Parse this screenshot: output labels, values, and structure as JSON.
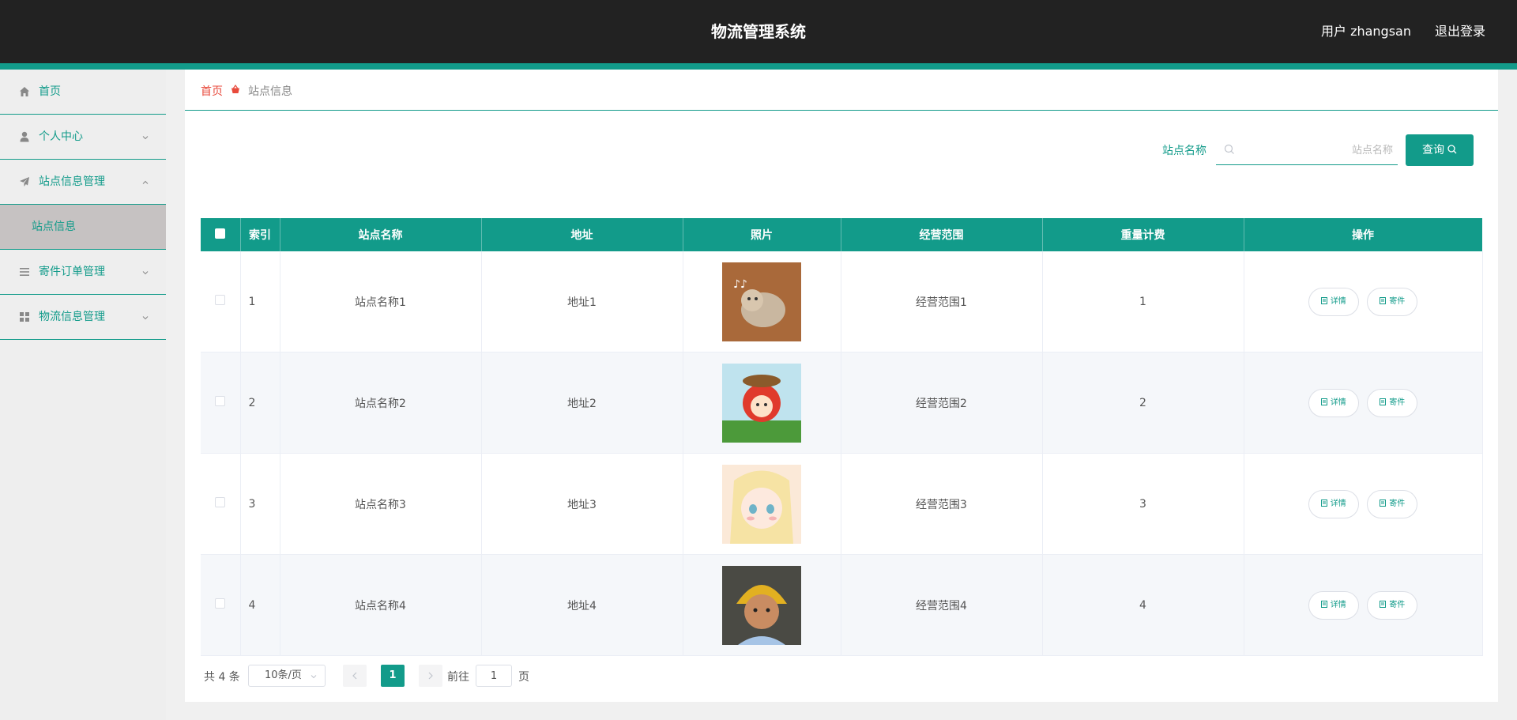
{
  "header": {
    "title": "物流管理系统",
    "user": "用户 zhangsan",
    "logout": "退出登录"
  },
  "sidebar": {
    "items": [
      {
        "label": "首页",
        "icon": "home-icon"
      },
      {
        "label": "个人中心",
        "icon": "user-icon"
      },
      {
        "label": "站点信息管理",
        "icon": "send-icon"
      },
      {
        "label": "寄件订单管理",
        "icon": "list-icon"
      },
      {
        "label": "物流信息管理",
        "icon": "grid-icon"
      }
    ],
    "submenu": [
      "站点信息"
    ]
  },
  "breadcrumb": {
    "home": "首页",
    "current": "站点信息"
  },
  "search": {
    "label": "站点名称",
    "placeholder": "站点名称",
    "button": "查询"
  },
  "table": {
    "columns": [
      "索引",
      "站点名称",
      "地址",
      "照片",
      "经营范围",
      "重量计费",
      "操作"
    ],
    "rows": [
      {
        "index": "1",
        "name": "站点名称1",
        "address": "地址1",
        "scope": "经营范围1",
        "fee": "1"
      },
      {
        "index": "2",
        "name": "站点名称2",
        "address": "地址2",
        "scope": "经营范围2",
        "fee": "2"
      },
      {
        "index": "3",
        "name": "站点名称3",
        "address": "地址3",
        "scope": "经营范围3",
        "fee": "3"
      },
      {
        "index": "4",
        "name": "站点名称4",
        "address": "地址4",
        "scope": "经营范围4",
        "fee": "4"
      }
    ],
    "actions": {
      "detail": "详情",
      "send": "寄件"
    }
  },
  "pagination": {
    "total": "共 4 条",
    "page_size": "10条/页",
    "current_page": "1",
    "goto_label": "前往",
    "goto_value": "1",
    "page_unit": "页"
  },
  "colors": {
    "accent": "#129b8a",
    "header": "#222222",
    "breadcrumb_home": "#e84a3c"
  }
}
